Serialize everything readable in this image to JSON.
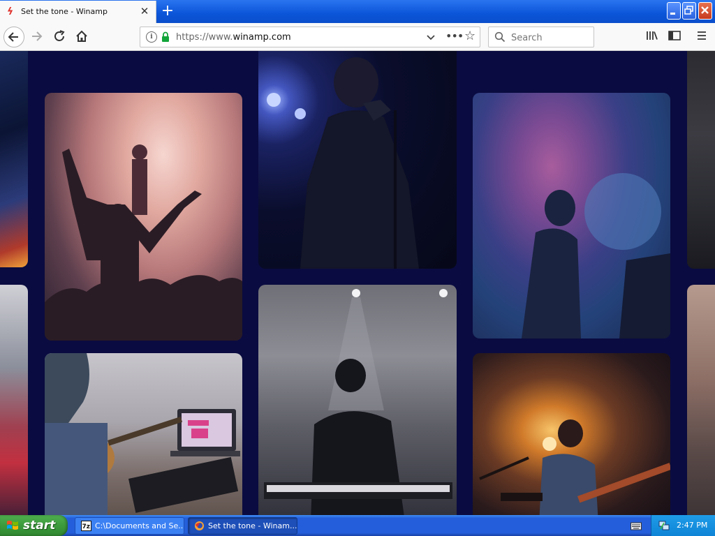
{
  "browser": {
    "tab_title": "Set the tone - Winamp",
    "url_prefix": "https://www.",
    "url_domain": "winamp.com",
    "search_placeholder": "Search"
  },
  "colors": {
    "page_background": "#0a0b40",
    "brand_accent": "#e0322b",
    "secure_lock": "#12a53a"
  },
  "gallery": {
    "items": [
      {
        "name": "concert-crowd-photo"
      },
      {
        "name": "singer-microphone-photo"
      },
      {
        "name": "smoke-performer-photo"
      },
      {
        "name": "guitar-laptop-photo"
      },
      {
        "name": "keyboard-player-photo"
      },
      {
        "name": "guitarist-stage-photo"
      }
    ]
  },
  "taskbar": {
    "start_label": "start",
    "task1_label": "C:\\Documents and Se...",
    "task2_label": "Set the tone - Winam...",
    "clock": "2:47 PM"
  }
}
